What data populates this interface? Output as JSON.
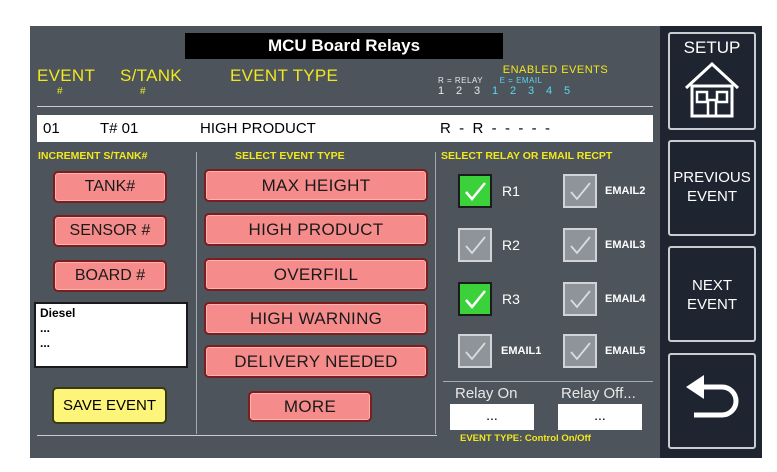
{
  "title": "MCU Board Relays",
  "headers": {
    "event": "EVENT",
    "event_sub": "#",
    "stank": "S/TANK",
    "stank_sub": "#",
    "event_type": "EVENT TYPE",
    "enabled_title": "ENABLED EVENTS",
    "relay_legend": "R = RELAY",
    "email_legend": "E = EMAIL",
    "relay_nums": [
      "1",
      "2",
      "3"
    ],
    "email_nums": [
      "1",
      "2",
      "3",
      "4",
      "5"
    ]
  },
  "event_row": {
    "number": "01",
    "tank": "T# 01",
    "type": "HIGH PRODUCT",
    "status": "R  -  R  -  -  -  -  -"
  },
  "increment": {
    "title": "INCREMENT S/TANK#",
    "buttons": [
      "TANK#",
      "SENSOR #",
      "BOARD #"
    ],
    "notes": [
      "Diesel",
      "...",
      "..."
    ],
    "save": "SAVE EVENT"
  },
  "event_types": {
    "title": "SELECT EVENT TYPE",
    "buttons": [
      "MAX HEIGHT",
      "HIGH PRODUCT",
      "OVERFILL",
      "HIGH WARNING",
      "DELIVERY NEEDED"
    ],
    "more": "MORE"
  },
  "relays": {
    "title": "SELECT RELAY OR EMAIL RECPT",
    "items": [
      {
        "label": "R1",
        "checked": true
      },
      {
        "label": "EMAIL2",
        "checked": false
      },
      {
        "label": "R2",
        "checked": false
      },
      {
        "label": "EMAIL3",
        "checked": false
      },
      {
        "label": "R3",
        "checked": true
      },
      {
        "label": "EMAIL4",
        "checked": false
      },
      {
        "label": "EMAIL1",
        "checked": false
      },
      {
        "label": "EMAIL5",
        "checked": false
      }
    ],
    "relay_on_label": "Relay On",
    "relay_off_label": "Relay Off...",
    "relay_on_value": "...",
    "relay_off_value": "...",
    "event_type_footer": "EVENT TYPE: Control On/Off"
  },
  "side_buttons": {
    "setup": "SETUP",
    "previous_line1": "PREVIOUS",
    "previous_line2": "EVENT",
    "next_line1": "NEXT",
    "next_line2": "EVENT"
  },
  "colors": {
    "panel_bg": "#4d545b",
    "header_yellow": "#f2e81e",
    "button_pink": "#f58b8b",
    "check_green": "#3ad13a",
    "save_yellow": "#fcf57a",
    "email_cyan": "#5ad7f0"
  }
}
